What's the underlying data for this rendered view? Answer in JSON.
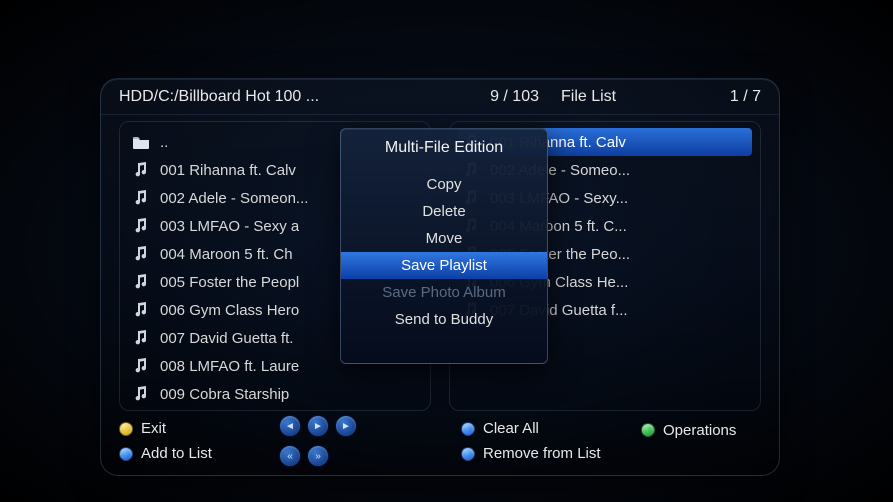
{
  "header": {
    "path": "HDD/C:/Billboard Hot 100 ...",
    "left_count": "9 / 103",
    "file_list_label": "File List",
    "right_count": "1 / 7"
  },
  "left_list": [
    {
      "type": "folder",
      "label": ".."
    },
    {
      "type": "music",
      "label": "001 Rihanna ft. Calv"
    },
    {
      "type": "music",
      "label": "002 Adele - Someon..."
    },
    {
      "type": "music",
      "label": "003 LMFAO - Sexy a"
    },
    {
      "type": "music",
      "label": "004 Maroon 5 ft. Ch"
    },
    {
      "type": "music",
      "label": "005 Foster the Peopl"
    },
    {
      "type": "music",
      "label": "006 Gym Class Hero"
    },
    {
      "type": "music",
      "label": "007 David Guetta ft."
    },
    {
      "type": "music",
      "label": "008 LMFAO ft. Laure"
    },
    {
      "type": "music",
      "label": "009 Cobra Starship"
    }
  ],
  "right_list": [
    {
      "label": "001 Rihanna ft. Calv",
      "selected": true
    },
    {
      "label": "002 Adele - Someo..."
    },
    {
      "label": "003 LMFAO - Sexy..."
    },
    {
      "label": "004 Maroon 5 ft. C..."
    },
    {
      "label": "005 Foster the Peo..."
    },
    {
      "label": "006 Gym Class He..."
    },
    {
      "label": "007 David Guetta f..."
    }
  ],
  "popup": {
    "title": "Multi-File Edition",
    "items": [
      {
        "label": "Copy"
      },
      {
        "label": "Delete"
      },
      {
        "label": "Move"
      },
      {
        "label": "Save Playlist",
        "selected": true
      },
      {
        "label": "Save Photo Album",
        "disabled": true
      },
      {
        "label": "Send to Buddy"
      }
    ]
  },
  "footer": {
    "exit": "Exit",
    "add": "Add to List",
    "clear": "Clear All",
    "operations": "Operations",
    "remove": "Remove from List",
    "ctrl_icons": [
      "prev",
      "play",
      "next",
      "rewind",
      "forward"
    ]
  },
  "colors": {
    "accent": "#1e5cc8"
  }
}
